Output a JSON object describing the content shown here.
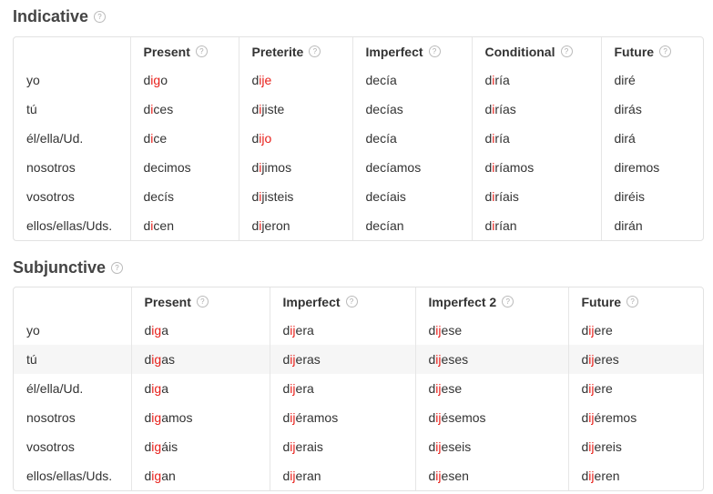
{
  "indicative": {
    "title": "Indicative",
    "help_icon": "question-circle-icon",
    "columns": [
      "Present",
      "Preterite",
      "Imperfect",
      "Conditional",
      "Future"
    ],
    "rows": [
      {
        "person": "yo",
        "cells": [
          [
            "d",
            "ig",
            "o"
          ],
          [
            "d",
            "ije",
            ""
          ],
          [
            "decía",
            "",
            ""
          ],
          [
            "d",
            "i",
            "ría"
          ],
          [
            "diré",
            "",
            ""
          ]
        ]
      },
      {
        "person": "tú",
        "cells": [
          [
            "d",
            "i",
            "ces"
          ],
          [
            "d",
            "i",
            "jiste"
          ],
          [
            "decías",
            "",
            ""
          ],
          [
            "d",
            "i",
            "rías"
          ],
          [
            "dirás",
            "",
            ""
          ]
        ]
      },
      {
        "person": "él/ella/Ud.",
        "cells": [
          [
            "d",
            "i",
            "ce"
          ],
          [
            "d",
            "ijo",
            ""
          ],
          [
            "decía",
            "",
            ""
          ],
          [
            "d",
            "i",
            "ría"
          ],
          [
            "dirá",
            "",
            ""
          ]
        ]
      },
      {
        "person": "nosotros",
        "cells": [
          [
            "decimos",
            "",
            ""
          ],
          [
            "d",
            "i",
            "jimos"
          ],
          [
            "decíamos",
            "",
            ""
          ],
          [
            "d",
            "i",
            "ríamos"
          ],
          [
            "diremos",
            "",
            ""
          ]
        ]
      },
      {
        "person": "vosotros",
        "cells": [
          [
            "decís",
            "",
            ""
          ],
          [
            "d",
            "i",
            "jisteis"
          ],
          [
            "decíais",
            "",
            ""
          ],
          [
            "d",
            "i",
            "ríais"
          ],
          [
            "diréis",
            "",
            ""
          ]
        ]
      },
      {
        "person": "ellos/ellas/Uds.",
        "cells": [
          [
            "d",
            "i",
            "cen"
          ],
          [
            "d",
            "i",
            "jeron"
          ],
          [
            "decían",
            "",
            ""
          ],
          [
            "d",
            "i",
            "rían"
          ],
          [
            "dirán",
            "",
            ""
          ]
        ]
      }
    ]
  },
  "subjunctive": {
    "title": "Subjunctive",
    "help_icon": "question-circle-icon",
    "columns": [
      "Present",
      "Imperfect",
      "Imperfect 2",
      "Future"
    ],
    "highlighted_row": "tú",
    "rows": [
      {
        "person": "yo",
        "cells": [
          [
            "d",
            "ig",
            "a"
          ],
          [
            "d",
            "ij",
            "era"
          ],
          [
            "d",
            "ij",
            "ese"
          ],
          [
            "d",
            "ij",
            "ere"
          ]
        ]
      },
      {
        "person": "tú",
        "cells": [
          [
            "d",
            "ig",
            "as"
          ],
          [
            "d",
            "ij",
            "eras"
          ],
          [
            "d",
            "ij",
            "eses"
          ],
          [
            "d",
            "ij",
            "eres"
          ]
        ]
      },
      {
        "person": "él/ella/Ud.",
        "cells": [
          [
            "d",
            "ig",
            "a"
          ],
          [
            "d",
            "ij",
            "era"
          ],
          [
            "d",
            "ij",
            "ese"
          ],
          [
            "d",
            "ij",
            "ere"
          ]
        ]
      },
      {
        "person": "nosotros",
        "cells": [
          [
            "d",
            "ig",
            "amos"
          ],
          [
            "d",
            "ij",
            "éramos"
          ],
          [
            "d",
            "ij",
            "ésemos"
          ],
          [
            "d",
            "ij",
            "éremos"
          ]
        ]
      },
      {
        "person": "vosotros",
        "cells": [
          [
            "d",
            "ig",
            "áis"
          ],
          [
            "d",
            "ij",
            "erais"
          ],
          [
            "d",
            "ij",
            "eseis"
          ],
          [
            "d",
            "ij",
            "ereis"
          ]
        ]
      },
      {
        "person": "ellos/ellas/Uds.",
        "cells": [
          [
            "d",
            "ig",
            "an"
          ],
          [
            "d",
            "ij",
            "eran"
          ],
          [
            "d",
            "ij",
            "esen"
          ],
          [
            "d",
            "ij",
            "eren"
          ]
        ]
      }
    ]
  },
  "colors": {
    "irregular": "#e8201b",
    "text": "#333333",
    "border": "#e2e2e2",
    "row_highlight": "#f6f6f6"
  }
}
